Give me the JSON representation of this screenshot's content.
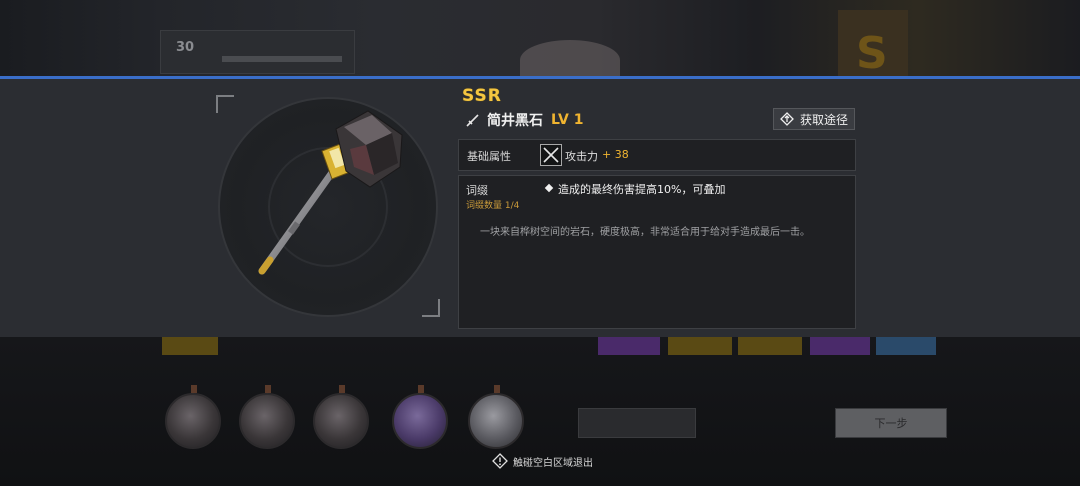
{
  "background": {
    "task_number": "30",
    "next_button_label": "下一步"
  },
  "item": {
    "rarity": "SSR",
    "name": "简井黑石",
    "level": "LV 1",
    "source_button": "获取途径",
    "base_attr_label": "基础属性",
    "stat_name": "攻击力",
    "stat_value": "+ 38",
    "affix_label": "词缀",
    "affix_count": "词缀数量 1/4",
    "affix_effect": "造成的最终伤害提高10%，可叠加",
    "description": "一块来自桦树空间的岩石，硬度极高，非常适合用于给对手造成最后一击。",
    "icon": "hammer-weapon"
  },
  "exit_hint": "触碰空白区域退出",
  "colors": {
    "accent_blue": "#3a6ec9",
    "rarity_gold": "#f5c640",
    "value_orange": "#f0b430",
    "panel_bg": "#2b2d32"
  }
}
